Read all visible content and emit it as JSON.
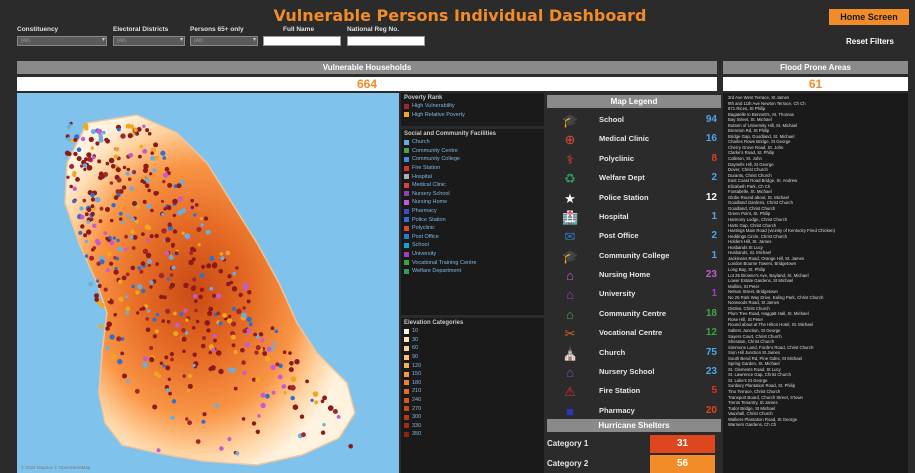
{
  "header": {
    "title": "Vulnerable Persons Individual Dashboard",
    "home_button": "Home Screen",
    "reset_button": "Reset Filters"
  },
  "filters": [
    {
      "label": "Constituency",
      "value": "(All)"
    },
    {
      "label": "Electoral Districts",
      "value": "(All)"
    },
    {
      "label": "Persons 65+ only",
      "value": "(All)"
    },
    {
      "label": "Full Name",
      "value": ""
    },
    {
      "label": "National Reg No.",
      "value": ""
    }
  ],
  "vulnerable": {
    "title": "Vulnerable Households",
    "count": "664"
  },
  "flood": {
    "title": "Flood Prone Areas",
    "count": "61",
    "areas": [
      "3rd Ave West Terrace, St James",
      "9th and 11th Ave Newton Terrace, Ch Ch",
      "871 Rices, St Philip",
      "Bagatelle to Bennett's, St. Thomas",
      "Bay Street, St. Michael",
      "Bottom of University Hill, St. Michael",
      "Brereton Rd, St Philip",
      "Bridge Gap, Goodland, St. Michael",
      "Charles Rowe Bridge, St George",
      "Cherry Grove Road, St. John",
      "Clarke's Road, St. Philip",
      "Colleton, St. John",
      "Daynells Hill, St George",
      "Dover, Christ Church",
      "Durants, Christ Church",
      "East Coast Road Bridge, St. Andrew",
      "Elizabeth Park, Ch Ch",
      "Fontabelle, St. Michael",
      "Globe Round about, St. Michael",
      "Goodland Gardens, Christ Church",
      "Goodland, Christ Church",
      "Green Point, St. Philip",
      "Harmony Lodge, Christ Church",
      "Harts Gap, Christ Church",
      "Hastings Main Road (vicinity of Kentucky Fried Chicken)",
      "Heddings Circle, Christ Church",
      "Holders Hill, St. James",
      "Husbands St Lucy",
      "Husbands, St. Michael",
      "Jackmans Road, Orange Hill, St. James",
      "London Bourne Towers, Bridgetown",
      "Long Bay, St. Philip",
      "Lot 25 Browne's Ave, Bayland, St. Michael",
      "Lower Estate Gardens, St Michael",
      "Mullins, St Peter",
      "Nelson Street, Bridgetown",
      "No 25 Park Way Drive, Ealing Park, Christ Church",
      "Norwoods Road, St James",
      "Oistins, Christ Church",
      "Plum Tree Road, Haggatt Hall, St. Michael",
      "Rose Hill, St Peter",
      "Round about at The Hilton Hotel, St. Michael",
      "Salters Junction, St George",
      "Sayers Court, Christ Church",
      "Sheraton, Christ Church",
      "Simmons Land, Forde's Road, Christ Church",
      "Sion Hill Junction St James",
      "South Bend Rd, Pine Gdns, St Michael",
      "Spring Garden, St. Michael",
      "St. Clements Road, St Lucy",
      "St. Lawrence Gap, Christ Church",
      "St. Luke's St George",
      "Sunbury Plantation Road, St. Philip",
      "Tino Terrace, Christ Church",
      "Transport Board, Church Street, S'town",
      "Trents Tenantry, St James",
      "Tudor Bridge, St Michael",
      "Vauxhall, Christ Church",
      "Walkers Plantation Road, St George",
      "Warners Gardens, Ch Ch"
    ]
  },
  "legend": {
    "poverty_title": "Poverty Rank",
    "poverty": [
      {
        "label": "High Vulnerability",
        "color": "#a0262a"
      },
      {
        "label": "High Relative Poverty",
        "color": "#f2a61f"
      }
    ],
    "facilities_title": "Social and Community Facilities",
    "facilities": [
      {
        "label": "Church",
        "color": "#6aaee0"
      },
      {
        "label": "Community Centre",
        "color": "#49a34a"
      },
      {
        "label": "Community College",
        "color": "#3b8de0"
      },
      {
        "label": "Fire Station",
        "color": "#d9342b"
      },
      {
        "label": "Hospital",
        "color": "#b0b0b0"
      },
      {
        "label": "Medical Clinic",
        "color": "#d8443c"
      },
      {
        "label": "Nursery School",
        "color": "#8e44ad"
      },
      {
        "label": "Nursing Home",
        "color": "#c35bd1"
      },
      {
        "label": "Pharmacy",
        "color": "#3c4cc2"
      },
      {
        "label": "Police Station",
        "color": "#2e6fd1"
      },
      {
        "label": "Polyclinic",
        "color": "#e0462e"
      },
      {
        "label": "Post Office",
        "color": "#2a7bc9"
      },
      {
        "label": "School",
        "color": "#1aa1d6"
      },
      {
        "label": "University",
        "color": "#9b3fc4"
      },
      {
        "label": "Vocational Training Centre",
        "color": "#3aa63a"
      },
      {
        "label": "Welfare Department",
        "color": "#2f9e5b"
      }
    ],
    "elevation_title": "Elevation Categories",
    "elevation": [
      {
        "label": "10",
        "color": "#fff3e0"
      },
      {
        "label": "30",
        "color": "#ffe4c2"
      },
      {
        "label": "60",
        "color": "#ffd3a0"
      },
      {
        "label": "90",
        "color": "#ffc07e"
      },
      {
        "label": "120",
        "color": "#fdaa5d"
      },
      {
        "label": "150",
        "color": "#f99545"
      },
      {
        "label": "180",
        "color": "#f07f33"
      },
      {
        "label": "210",
        "color": "#e56b25"
      },
      {
        "label": "240",
        "color": "#d9591b"
      },
      {
        "label": "270",
        "color": "#c94914"
      },
      {
        "label": "300",
        "color": "#b73a0f"
      },
      {
        "label": "330",
        "color": "#a42e0b"
      },
      {
        "label": "350",
        "color": "#8f2408"
      }
    ]
  },
  "map_legend": {
    "title": "Map Legend",
    "items": [
      {
        "label": "School",
        "count": "94",
        "icon": "school-icon",
        "glyph": "🎓",
        "icon_color": "#1aa1d6",
        "count_color": "#4da6e6"
      },
      {
        "label": "Medical Clinic",
        "count": "16",
        "icon": "medical-clinic-icon",
        "glyph": "⊕",
        "icon_color": "#e04a3a",
        "count_color": "#4da6e6"
      },
      {
        "label": "Polyclinic",
        "count": "8",
        "icon": "polyclinic-icon",
        "glyph": "⚕",
        "icon_color": "#e0462e",
        "count_color": "#e03a2a"
      },
      {
        "label": "Welfare Dept",
        "count": "2",
        "icon": "welfare-icon",
        "glyph": "♻",
        "icon_color": "#2f9e5b",
        "count_color": "#4da6e6"
      },
      {
        "label": "Police Station",
        "count": "12",
        "icon": "police-icon",
        "glyph": "★",
        "icon_color": "#ffffff",
        "count_color": "#ffffff"
      },
      {
        "label": "Hospital",
        "count": "1",
        "icon": "hospital-icon",
        "glyph": "🏥",
        "icon_color": "#9fb7d6",
        "count_color": "#4da6e6"
      },
      {
        "label": "Post Office",
        "count": "2",
        "icon": "post-office-icon",
        "glyph": "✉",
        "icon_color": "#2a7bc9",
        "count_color": "#4da6e6"
      },
      {
        "label": "Community College",
        "count": "1",
        "icon": "community-college-icon",
        "glyph": "🎓",
        "icon_color": "#d9342b",
        "count_color": "#4da6e6"
      },
      {
        "label": "Nursing Home",
        "count": "23",
        "icon": "nursing-home-icon",
        "glyph": "⌂",
        "icon_color": "#c35bd1",
        "count_color": "#c35bd1"
      },
      {
        "label": "University",
        "count": "1",
        "icon": "university-icon",
        "glyph": "⌂",
        "icon_color": "#9b3fc4",
        "count_color": "#9b3fc4"
      },
      {
        "label": "Community Centre",
        "count": "18",
        "icon": "community-centre-icon",
        "glyph": "⌂",
        "icon_color": "#49a34a",
        "count_color": "#49a34a"
      },
      {
        "label": "Vocational Centre",
        "count": "12",
        "icon": "vocational-icon",
        "glyph": "✂",
        "icon_color": "#e0601e",
        "count_color": "#3aa63a"
      },
      {
        "label": "Church",
        "count": "75",
        "icon": "church-icon",
        "glyph": "⛪",
        "icon_color": "#4da6e6",
        "count_color": "#4da6e6"
      },
      {
        "label": "Nursery School",
        "count": "23",
        "icon": "nursery-school-icon",
        "glyph": "⌂",
        "icon_color": "#8e44ad",
        "count_color": "#4da6e6"
      },
      {
        "label": "Fire Station",
        "count": "5",
        "icon": "fire-station-icon",
        "glyph": "⚠",
        "icon_color": "#d9342b",
        "count_color": "#d9342b"
      },
      {
        "label": "Pharmacy",
        "count": "20",
        "icon": "pharmacy-icon",
        "glyph": "■",
        "icon_color": "#2b36b8",
        "count_color": "#e0461e"
      }
    ]
  },
  "shelters": {
    "title": "Hurricane Shelters",
    "rows": [
      {
        "label": "Category 1",
        "value": "31",
        "color": "#e0461e"
      },
      {
        "label": "Category 2",
        "value": "56",
        "color": "#f28c28"
      }
    ]
  },
  "map": {
    "attribution": "© 2022 Mapbox © OpenStreetMap"
  },
  "colors": {
    "accent": "#f28c28",
    "panel": "#1a1a1a",
    "header_bar": "#8a8a8a",
    "map_bg": "#7fc3ec"
  }
}
